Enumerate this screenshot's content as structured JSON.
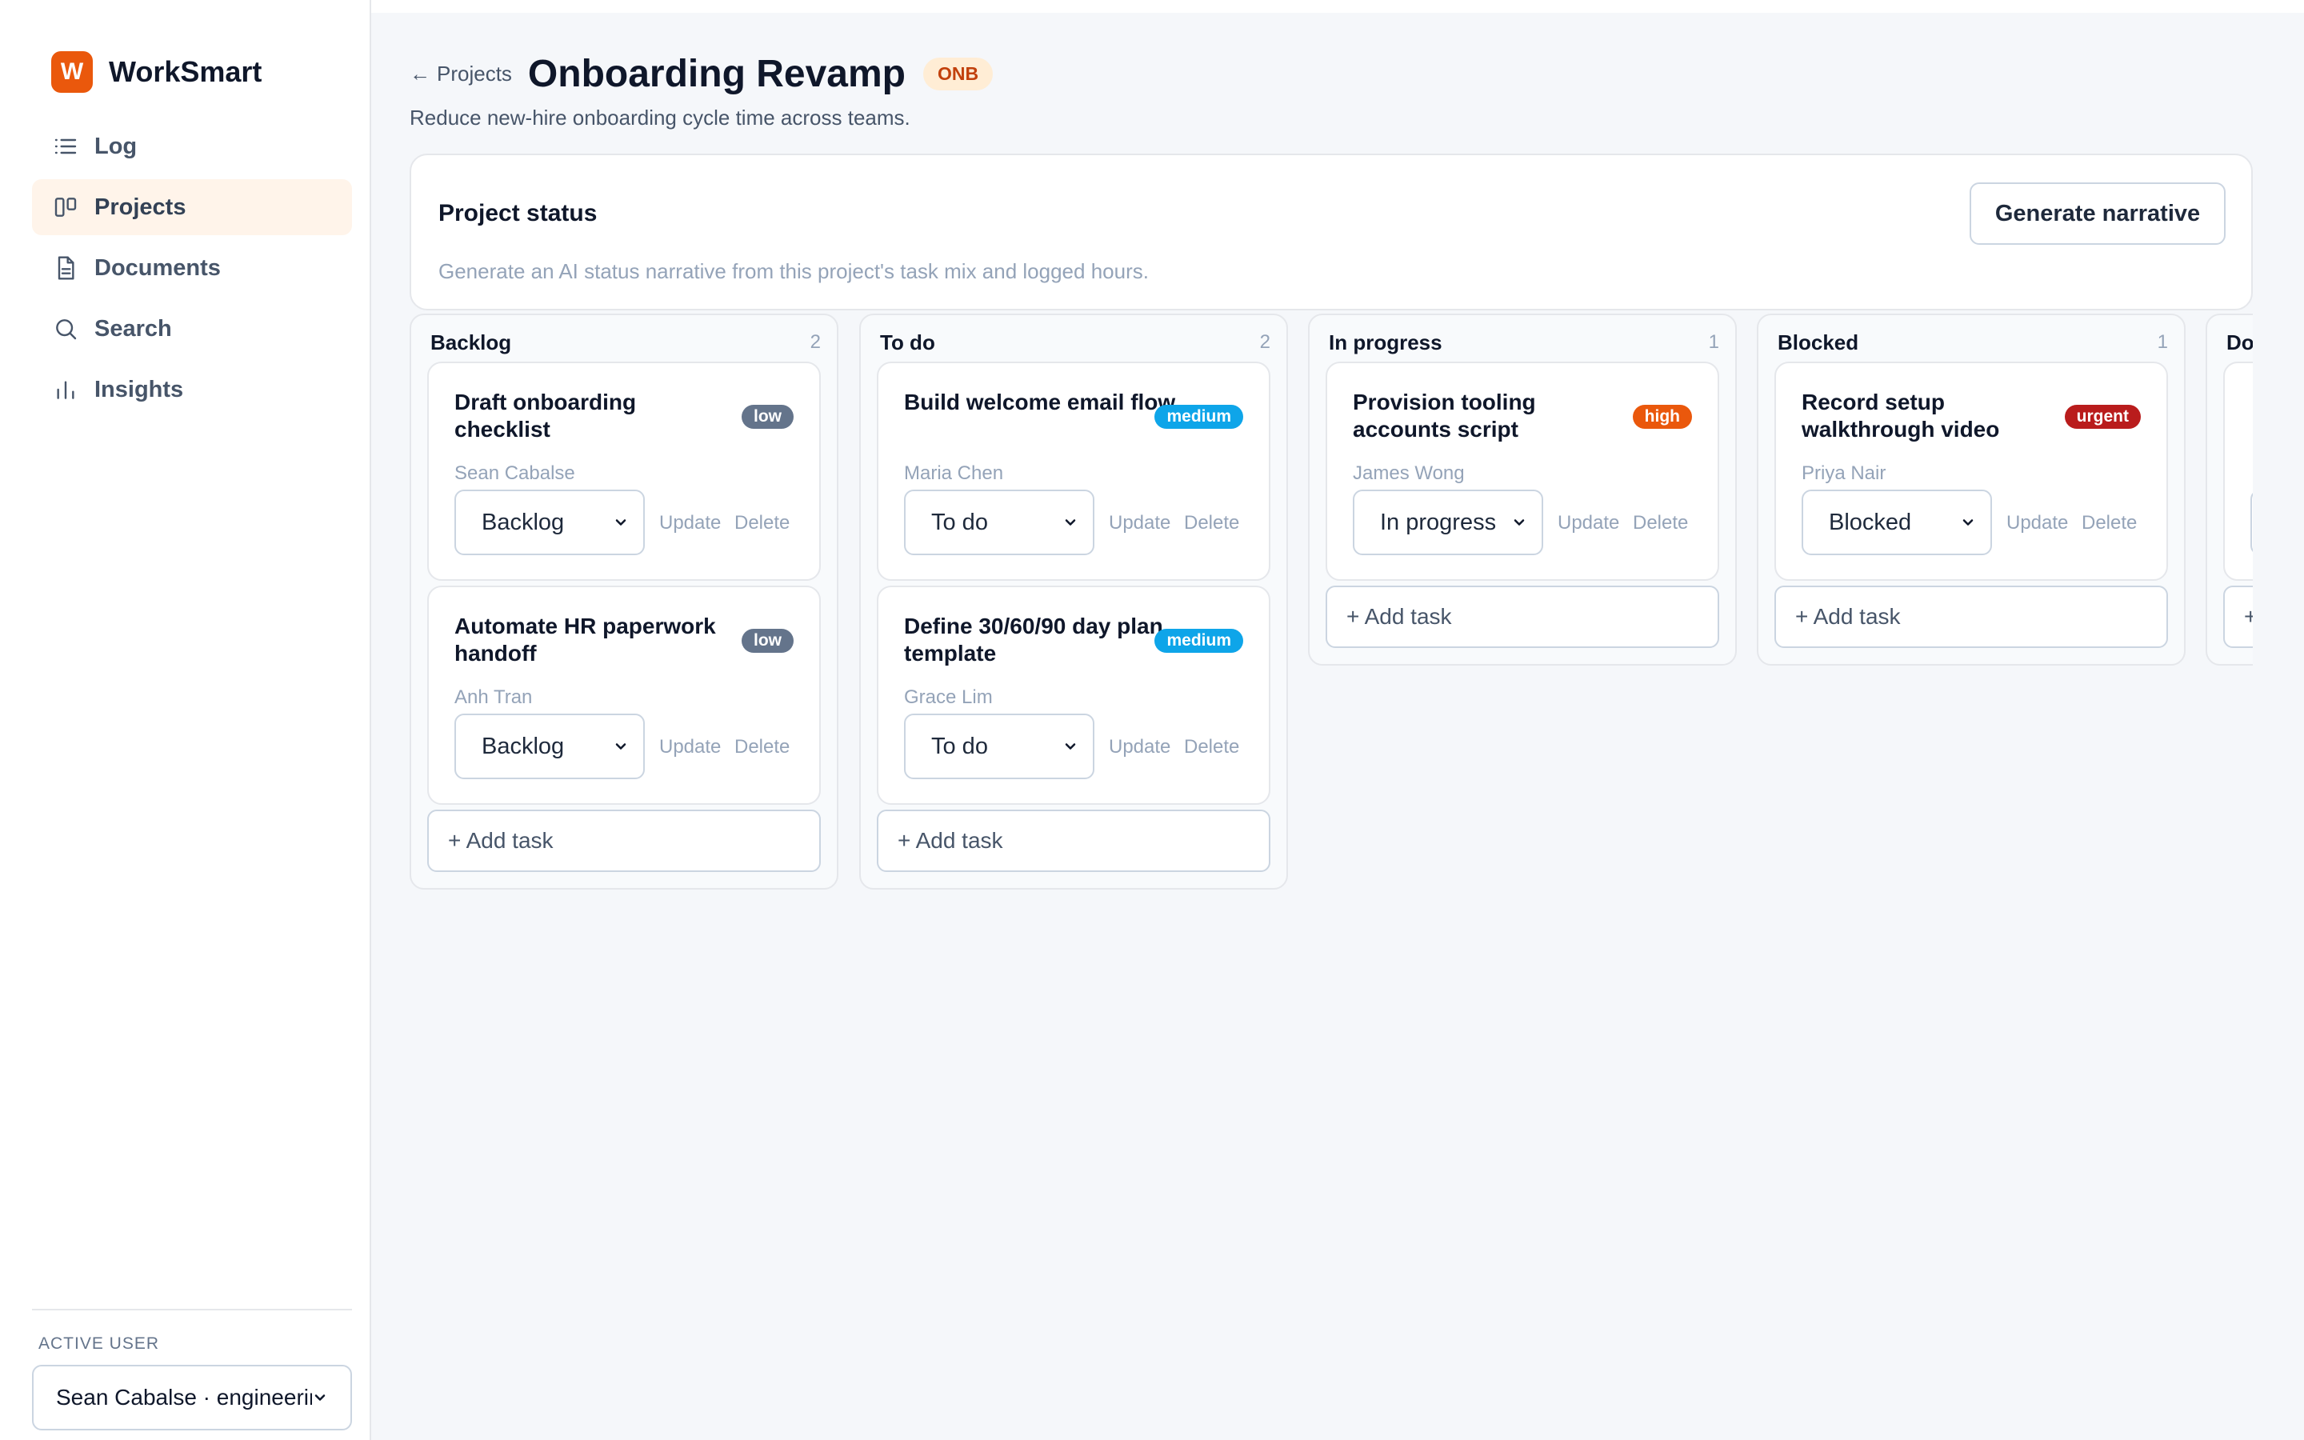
{
  "brand": {
    "logo_letter": "W",
    "name": "WorkSmart",
    "accent": "#ea580c"
  },
  "nav": {
    "items": [
      {
        "label": "Log",
        "icon": "list-icon",
        "active": false
      },
      {
        "label": "Projects",
        "icon": "kanban-icon",
        "active": true
      },
      {
        "label": "Documents",
        "icon": "document-icon",
        "active": false
      },
      {
        "label": "Search",
        "icon": "search-icon",
        "active": false
      },
      {
        "label": "Insights",
        "icon": "bar-chart-icon",
        "active": false
      }
    ]
  },
  "active_user": {
    "label": "ACTIVE USER",
    "selected": "Sean Cabalse · engineering"
  },
  "header": {
    "back_label": "Projects",
    "title": "Onboarding Revamp",
    "code": "ONB",
    "subtitle": "Reduce new-hire onboarding cycle time across teams."
  },
  "status_card": {
    "title": "Project status",
    "description": "Generate an AI status narrative from this project's task mix and logged hours.",
    "button_label": "Generate narrative"
  },
  "task_actions": {
    "update": "Update",
    "delete": "Delete",
    "add_task": "+ Add task"
  },
  "columns": [
    {
      "name": "Backlog",
      "count": "2",
      "tasks": [
        {
          "title": "Draft onboarding checklist",
          "assignee": "Sean Cabalse",
          "priority": "low",
          "status": "Backlog"
        },
        {
          "title": "Automate HR paperwork handoff",
          "assignee": "Anh Tran",
          "priority": "low",
          "status": "Backlog"
        }
      ]
    },
    {
      "name": "To do",
      "count": "2",
      "tasks": [
        {
          "title": "Build welcome email flow",
          "assignee": "Maria Chen",
          "priority": "medium",
          "status": "To do"
        },
        {
          "title": "Define 30/60/90 day plan template",
          "assignee": "Grace Lim",
          "priority": "medium",
          "status": "To do"
        }
      ]
    },
    {
      "name": "In progress",
      "count": "1",
      "tasks": [
        {
          "title": "Provision tooling accounts script",
          "assignee": "James Wong",
          "priority": "high",
          "status": "In progress"
        }
      ]
    },
    {
      "name": "Blocked",
      "count": "1",
      "tasks": [
        {
          "title": "Record setup walkthrough video",
          "assignee": "Priya Nair",
          "priority": "urgent",
          "status": "Blocked"
        }
      ]
    },
    {
      "name": "Done",
      "count": "",
      "tasks": [
        {
          "title": "",
          "assignee": "",
          "priority": "",
          "status": ""
        }
      ]
    }
  ]
}
